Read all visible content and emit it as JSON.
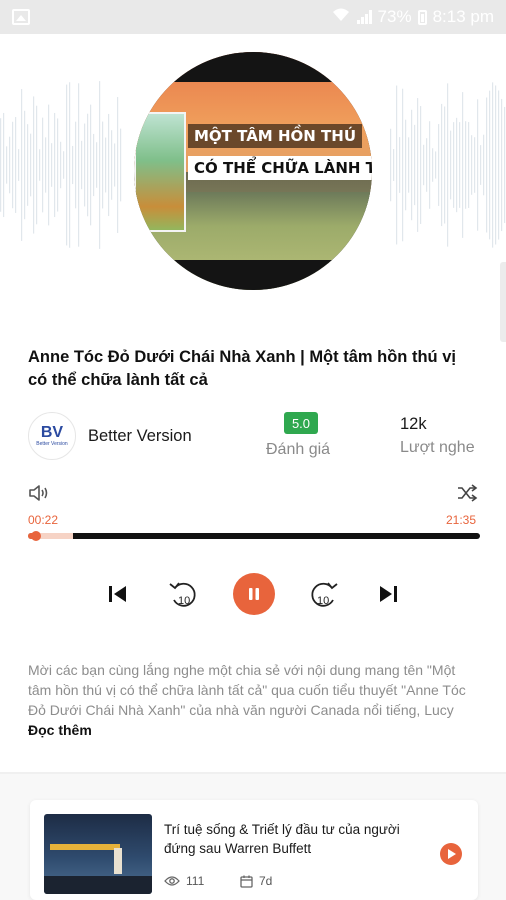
{
  "status_bar": {
    "battery": "73%",
    "time": "8:13 pm"
  },
  "cover": {
    "title_line1": "MỘT TÂM HỒN THÚ",
    "title_line2": "CÓ THỂ CHỮA LÀNH TẤT"
  },
  "track": {
    "title": "Anne Tóc Đỏ Dưới Chái Nhà Xanh | Một tâm hồn thú vị có thể chữa lành tất cả"
  },
  "channel": {
    "logo_text": "BV",
    "logo_subtext": "Better Version",
    "name": "Better Version"
  },
  "rating": {
    "value": "5.0",
    "label": "Đánh giá"
  },
  "listens": {
    "count": "12k",
    "label": "Lượt nghe"
  },
  "player": {
    "current_time": "00:22",
    "total_time": "21:35",
    "progress_fraction": 0.017,
    "buffered_fraction": 0.1,
    "rewind_seconds": "10",
    "forward_seconds": "10",
    "accent_color": "#e8643c",
    "icons": [
      "volume-icon",
      "shuffle-icon",
      "skip-previous-icon",
      "rewind-10-icon",
      "pause-icon",
      "forward-10-icon",
      "skip-next-icon"
    ]
  },
  "description": {
    "text": "Mời các bạn cùng lắng nghe một chia sẻ với nội dung mang tên \"Một tâm hồn thú vị có thể chữa lành tất cả\" qua cuốn tiểu thuyết \"Anne Tóc Đỏ Dưới Chái Nhà Xanh\" của nhà văn người Canada nổi tiếng, Lucy",
    "read_more": "Đọc thêm"
  },
  "related": {
    "title": "Trí tuệ sống & Triết lý đầu tư của người đứng sau Warren Buffett",
    "views": "111",
    "age": "7d"
  }
}
